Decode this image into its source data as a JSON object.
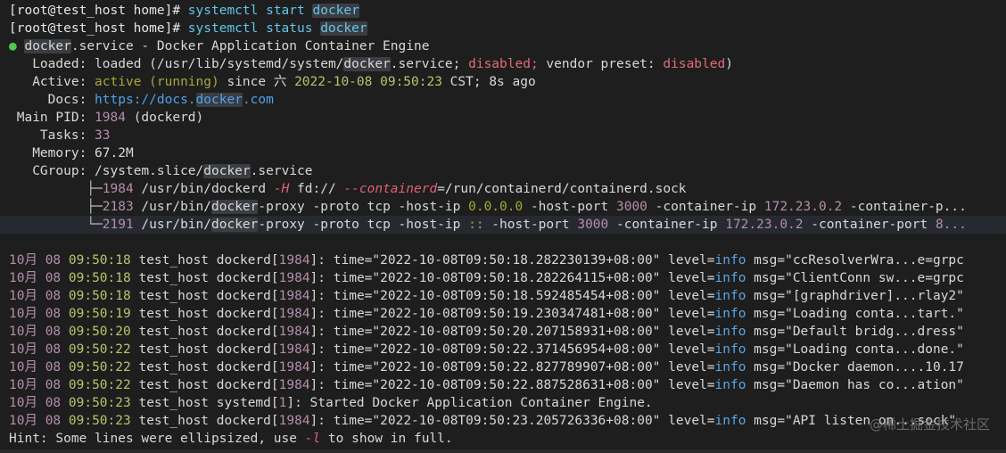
{
  "prompt": "[root@test_host home]#",
  "cmd1": {
    "a": "systemctl start ",
    "b": "docker"
  },
  "cmd2": {
    "a": "systemctl status ",
    "b": "docker"
  },
  "svc": {
    "bullet": "●",
    "name": "docker",
    "rest": ".service - Docker Application Container Engine"
  },
  "loaded": {
    "label": "Loaded:",
    "a": "loaded (/usr/lib/systemd/system/",
    "b": "docker",
    ".c": ".service; ",
    "d": "disabled;",
    "e": " vendor preset: ",
    "f": "disabled",
    "g": ")"
  },
  "active": {
    "label": "Active:",
    "a": "active (running)",
    "b": " since 六 ",
    "c": "2022-10-08 09:50:23",
    "d": " CST; 8s ago"
  },
  "docs": {
    "label": "Docs:",
    "a": "https://docs.",
    "b": "docker",
    "c": ".com"
  },
  "pid": {
    "label": "Main PID:",
    "a": "1984",
    "b": " (dockerd)"
  },
  "tasks": {
    "label": "Tasks:",
    "a": "33"
  },
  "memory": {
    "label": "Memory:",
    "a": "67.2M"
  },
  "cgroup": {
    "label": "CGroup:",
    "a": "/system.slice/",
    "b": "docker",
    "c": ".service"
  },
  "tree1": {
    "branch": "├─",
    "pid": "1984",
    "a": " /usr/bin/dockerd ",
    "o1": "-H",
    "b": " fd:// ",
    "o2": "--containerd",
    "c": "=/run/containerd/containerd.sock"
  },
  "tree2": {
    "branch": "├─",
    "pid": "2183",
    "a": " /usr/bin/",
    "b": "docker",
    "c": "-proxy -proto tcp -host-ip ",
    "ip": "0.0.0.0",
    "d": " -host-port ",
    "port": "3000",
    "e": " -container-ip ",
    "cip": "172.23.0.2",
    "f": " -container-p..."
  },
  "tree3": {
    "branch": "└─",
    "pid": "2191",
    "a": " /usr/bin/",
    "b": "docker",
    "c": "-proxy -proto tcp -host-ip ",
    "ip": "::",
    "d": " -host-port ",
    "port": "3000",
    "e": " -container-ip ",
    "cip": "172.23.0.2",
    "f": " -container-port ",
    "g": "8..."
  },
  "logs": [
    {
      "date": "10月 08",
      "time": "09:50:18",
      "host": "test_host",
      "proc": "dockerd",
      "pid": "1984",
      "msg": "time=\"2022-10-08T09:50:18.282230139+08:00\" ",
      "lvl": "level=",
      "lv": "info",
      "tail": " msg=\"ccResolverWra...e=grpc"
    },
    {
      "date": "10月 08",
      "time": "09:50:18",
      "host": "test_host",
      "proc": "dockerd",
      "pid": "1984",
      "msg": "time=\"2022-10-08T09:50:18.282264115+08:00\" ",
      "lvl": "level=",
      "lv": "info",
      "tail": " msg=\"ClientConn sw...e=grpc"
    },
    {
      "date": "10月 08",
      "time": "09:50:18",
      "host": "test_host",
      "proc": "dockerd",
      "pid": "1984",
      "msg": "time=\"2022-10-08T09:50:18.592485454+08:00\" ",
      "lvl": "level=",
      "lv": "info",
      "tail": " msg=\"[graphdriver]...rlay2\""
    },
    {
      "date": "10月 08",
      "time": "09:50:19",
      "host": "test_host",
      "proc": "dockerd",
      "pid": "1984",
      "msg": "time=\"2022-10-08T09:50:19.230347481+08:00\" ",
      "lvl": "level=",
      "lv": "info",
      "tail": " msg=\"Loading conta...tart.\""
    },
    {
      "date": "10月 08",
      "time": "09:50:20",
      "host": "test_host",
      "proc": "dockerd",
      "pid": "1984",
      "msg": "time=\"2022-10-08T09:50:20.207158931+08:00\" ",
      "lvl": "level=",
      "lv": "info",
      "tail": " msg=\"Default bridg...dress\""
    },
    {
      "date": "10月 08",
      "time": "09:50:22",
      "host": "test_host",
      "proc": "dockerd",
      "pid": "1984",
      "msg": "time=\"2022-10-08T09:50:22.371456954+08:00\" ",
      "lvl": "level=",
      "lv": "info",
      "tail": " msg=\"Loading conta...done.\""
    },
    {
      "date": "10月 08",
      "time": "09:50:22",
      "host": "test_host",
      "proc": "dockerd",
      "pid": "1984",
      "msg": "time=\"2022-10-08T09:50:22.827789907+08:00\" ",
      "lvl": "level=",
      "lv": "info",
      "tail": " msg=\"Docker daemon....10.17"
    },
    {
      "date": "10月 08",
      "time": "09:50:22",
      "host": "test_host",
      "proc": "dockerd",
      "pid": "1984",
      "msg": "time=\"2022-10-08T09:50:22.887528631+08:00\" ",
      "lvl": "level=",
      "lv": "info",
      "tail": " msg=\"Daemon has co...ation\""
    }
  ],
  "log_sysd": {
    "date": "10月 08",
    "time": "09:50:23",
    "host": "test_host",
    "proc": "systemd",
    "pid": "1",
    "msg": ": Started Docker Application Container Engine."
  },
  "log_last": {
    "date": "10月 08",
    "time": "09:50:23",
    "host": "test_host",
    "proc": "dockerd",
    "pid": "1984",
    "msg": "time=\"2022-10-08T09:50:23.205726336+08:00\" ",
    "lvl": "level=",
    "lv": "info",
    "tail": " msg=\"API listen on...sock\""
  },
  "hint": {
    "a": "Hint: Some lines were ellipsized, use ",
    "opt": "-l",
    "b": " to show in full."
  },
  "watermark": "@稀土掘金技术社区",
  "colors": {
    "bg": "#1e1e1e",
    "cmd": "#63c5ea",
    "green": "#4ec94e",
    "red": "#e06c75",
    "link": "#4fa3ef",
    "num": "#b48ead"
  }
}
